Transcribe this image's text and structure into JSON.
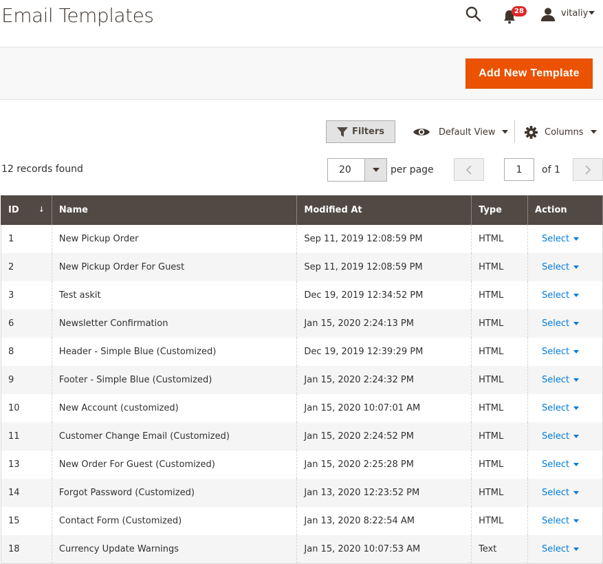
{
  "header": {
    "title": "Email Templates",
    "notification_count": "28",
    "user_name": "vitaliy"
  },
  "action_bar": {
    "add_button_label": "Add New Template"
  },
  "toolbar": {
    "filters_label": "Filters",
    "view_label": "Default View",
    "columns_label": "Columns"
  },
  "pager": {
    "records_found": "12 records found",
    "per_page_value": "20",
    "per_page_label": "per page",
    "current_page": "1",
    "of_label": "of 1"
  },
  "grid": {
    "columns": [
      "ID",
      "Name",
      "Modified At",
      "Type",
      "Action"
    ],
    "sort_indicator": "↓",
    "action_label": "Select",
    "rows": [
      {
        "id": "1",
        "name": "New Pickup Order",
        "modified": "Sep 11, 2019 12:08:59 PM",
        "type": "HTML"
      },
      {
        "id": "2",
        "name": "New Pickup Order For Guest",
        "modified": "Sep 11, 2019 12:08:59 PM",
        "type": "HTML"
      },
      {
        "id": "3",
        "name": "Test askit",
        "modified": "Dec 19, 2019 12:34:52 PM",
        "type": "HTML"
      },
      {
        "id": "6",
        "name": "Newsletter Confirmation",
        "modified": "Jan 15, 2020 2:24:13 PM",
        "type": "HTML"
      },
      {
        "id": "8",
        "name": "Header - Simple Blue (Customized)",
        "modified": "Dec 19, 2019 12:39:29 PM",
        "type": "HTML"
      },
      {
        "id": "9",
        "name": "Footer - Simple Blue (Customized)",
        "modified": "Jan 15, 2020 2:24:32 PM",
        "type": "HTML"
      },
      {
        "id": "10",
        "name": "New Account (customized)",
        "modified": "Jan 15, 2020 10:07:01 AM",
        "type": "HTML"
      },
      {
        "id": "11",
        "name": "Customer Change Email (Customized)",
        "modified": "Jan 15, 2020 2:24:52 PM",
        "type": "HTML"
      },
      {
        "id": "13",
        "name": "New Order For Guest (Customized)",
        "modified": "Jan 15, 2020 2:25:28 PM",
        "type": "HTML"
      },
      {
        "id": "14",
        "name": "Forgot Password (Customized)",
        "modified": "Jan 13, 2020 12:23:52 PM",
        "type": "HTML"
      },
      {
        "id": "15",
        "name": "Contact Form (Customized)",
        "modified": "Jan 13, 2020 8:22:54 AM",
        "type": "HTML"
      },
      {
        "id": "18",
        "name": "Currency Update Warnings",
        "modified": "Jan 15, 2020 10:07:53 AM",
        "type": "Text"
      }
    ]
  },
  "colors": {
    "accent": "#eb5202",
    "grid_header": "#514943",
    "link": "#007bdb",
    "badge": "#e22626"
  },
  "icons": [
    "search-icon",
    "bell-icon",
    "user-icon",
    "caret-down-icon",
    "filter-icon",
    "eye-icon",
    "gear-icon",
    "chevron-left-icon",
    "chevron-right-icon"
  ]
}
